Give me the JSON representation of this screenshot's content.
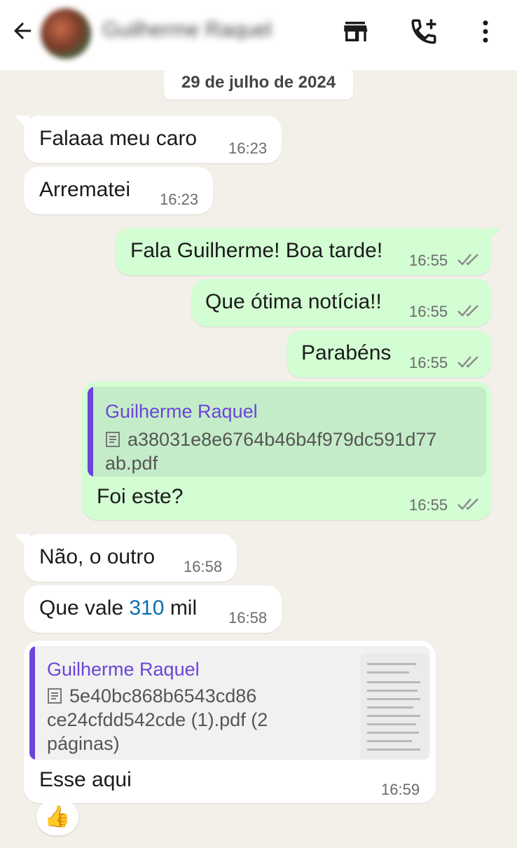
{
  "header": {
    "contact_name": "Guilherme Raquel",
    "icons": [
      "back-arrow-icon",
      "store-icon",
      "add-call-icon",
      "more-vert-icon"
    ]
  },
  "date_divider": "29 de julho de 2024",
  "messages": [
    {
      "direction": "in",
      "text": "Falaaa meu caro",
      "time": "16:23"
    },
    {
      "direction": "in",
      "text": "Arrematei",
      "time": "16:23"
    },
    {
      "direction": "out",
      "text": "Fala Guilherme! Boa tarde!",
      "time": "16:55",
      "status": "read"
    },
    {
      "direction": "out",
      "text": "Que ótima notícia!!",
      "time": "16:55",
      "status": "read"
    },
    {
      "direction": "out",
      "text": "Parabéns",
      "time": "16:55",
      "status": "read"
    },
    {
      "direction": "out",
      "quote": {
        "author": "Guilherme Raquel",
        "file_line1": "a38031e8e6764b46b4f979dc591d77",
        "file_line2": "ab.pdf"
      },
      "text": "Foi este?",
      "time": "16:55",
      "status": "read"
    },
    {
      "direction": "in",
      "text": "Não, o outro",
      "time": "16:58"
    },
    {
      "direction": "in",
      "text_before": "Que vale ",
      "number": "310",
      "text_after": " mil",
      "time": "16:58"
    },
    {
      "direction": "in",
      "quote": {
        "author": "Guilherme Raquel",
        "file_line1": "5e40bc868b6543cd86",
        "file_line2": "ce24cfdd542cde (1).pdf (2",
        "file_line3": "páginas)"
      },
      "text": "Esse aqui",
      "time": "16:59",
      "reaction": "👍"
    }
  ],
  "colors": {
    "chat_background": "#f3efe9",
    "outgoing_bubble": "#d3fdd3",
    "incoming_bubble": "#ffffff",
    "quote_accent": "#6b45d9",
    "link_number": "#0a6fb0"
  }
}
